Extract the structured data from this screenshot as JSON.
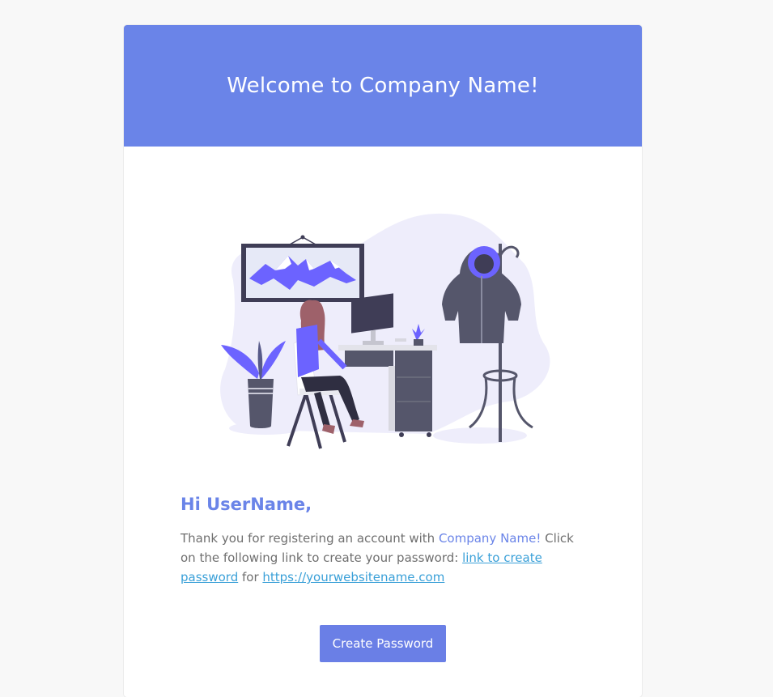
{
  "header": {
    "title": "Welcome to Company Name!"
  },
  "message": {
    "greeting": "Hi UserName,",
    "intro": "Thank you for registering an account with ",
    "company": "Company Name!",
    "after_company": " Click on the following link to create your password: ",
    "password_link": "link to create password",
    "for_text": " for ",
    "website_link": "https://yourwebsitename.com"
  },
  "cta": {
    "label": "Create Password"
  },
  "colors": {
    "accent": "#6a84e8",
    "link": "#3aa0d8",
    "text": "#6f6f6f"
  },
  "illustration": {
    "icon": "office-desk-illustration"
  }
}
